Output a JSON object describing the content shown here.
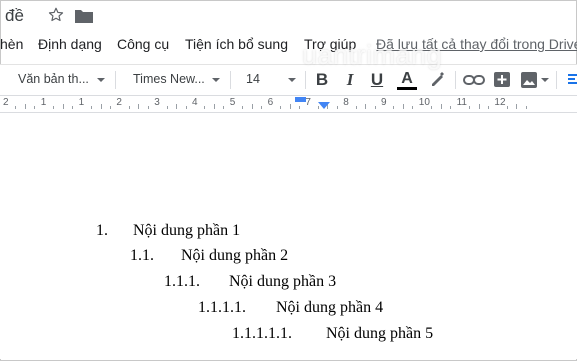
{
  "document": {
    "title": "đề"
  },
  "menu": {
    "items": [
      "hèn",
      "Định dạng",
      "Công cụ",
      "Tiện ích bổ sung",
      "Trợ giúp"
    ],
    "save_status": "Đã lưu tất cả thay đổi trong Drive"
  },
  "toolbar": {
    "style_select": "Văn bản th...",
    "font_select": "Times New...",
    "font_size": "14",
    "bold_label": "B",
    "italic_label": "I",
    "underline_label": "U",
    "text_color_label": "A"
  },
  "ruler": {
    "labels": [
      "2",
      "1",
      "1",
      "2",
      "3",
      "4",
      "5",
      "6",
      "7",
      "8",
      "9",
      "10",
      "11",
      "12"
    ]
  },
  "content": {
    "list_items": [
      {
        "number": "1.",
        "text": "Nội dung phần 1"
      },
      {
        "number": "1.1.",
        "text": "Nội dung phần 2"
      },
      {
        "number": "1.1.1.",
        "text": "Nội dung phần 3"
      },
      {
        "number": "1.1.1.1.",
        "text": "Nội dung phần 4"
      },
      {
        "number": "1.1.1.1.1.",
        "text": "Nội dung phần 5"
      }
    ]
  },
  "watermark": "uantrimang",
  "colors": {
    "ruler_marker": "#4285f4",
    "icon_gray": "#5f6368",
    "text_color_bar": "#000000"
  }
}
